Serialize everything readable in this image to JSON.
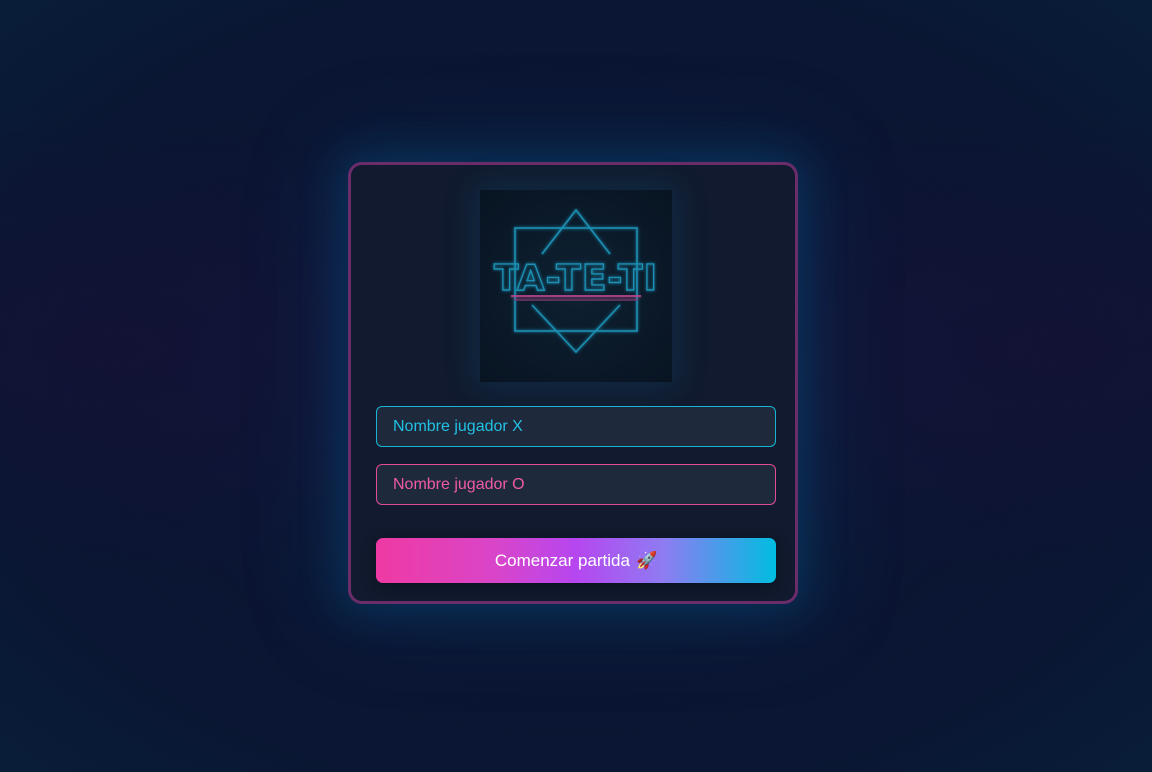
{
  "logo": {
    "text": "TA-TE-TI",
    "colors": {
      "neon_blue": "#1a8fb3",
      "neon_pink": "#c0468f"
    }
  },
  "form": {
    "player_x": {
      "placeholder": "Nombre jugador X",
      "value": ""
    },
    "player_o": {
      "placeholder": "Nombre jugador O",
      "value": ""
    },
    "start_button": {
      "label": "Comenzar partida",
      "icon": "rocket-icon",
      "icon_glyph": "🚀"
    }
  },
  "theme": {
    "card_border": "#6b2c6a",
    "accent_cyan": "#22c1e2",
    "accent_pink": "#ef5aa8",
    "gradient_start": "#ef3aa3",
    "gradient_mid": "#b646f0",
    "gradient_end": "#00bde0"
  }
}
